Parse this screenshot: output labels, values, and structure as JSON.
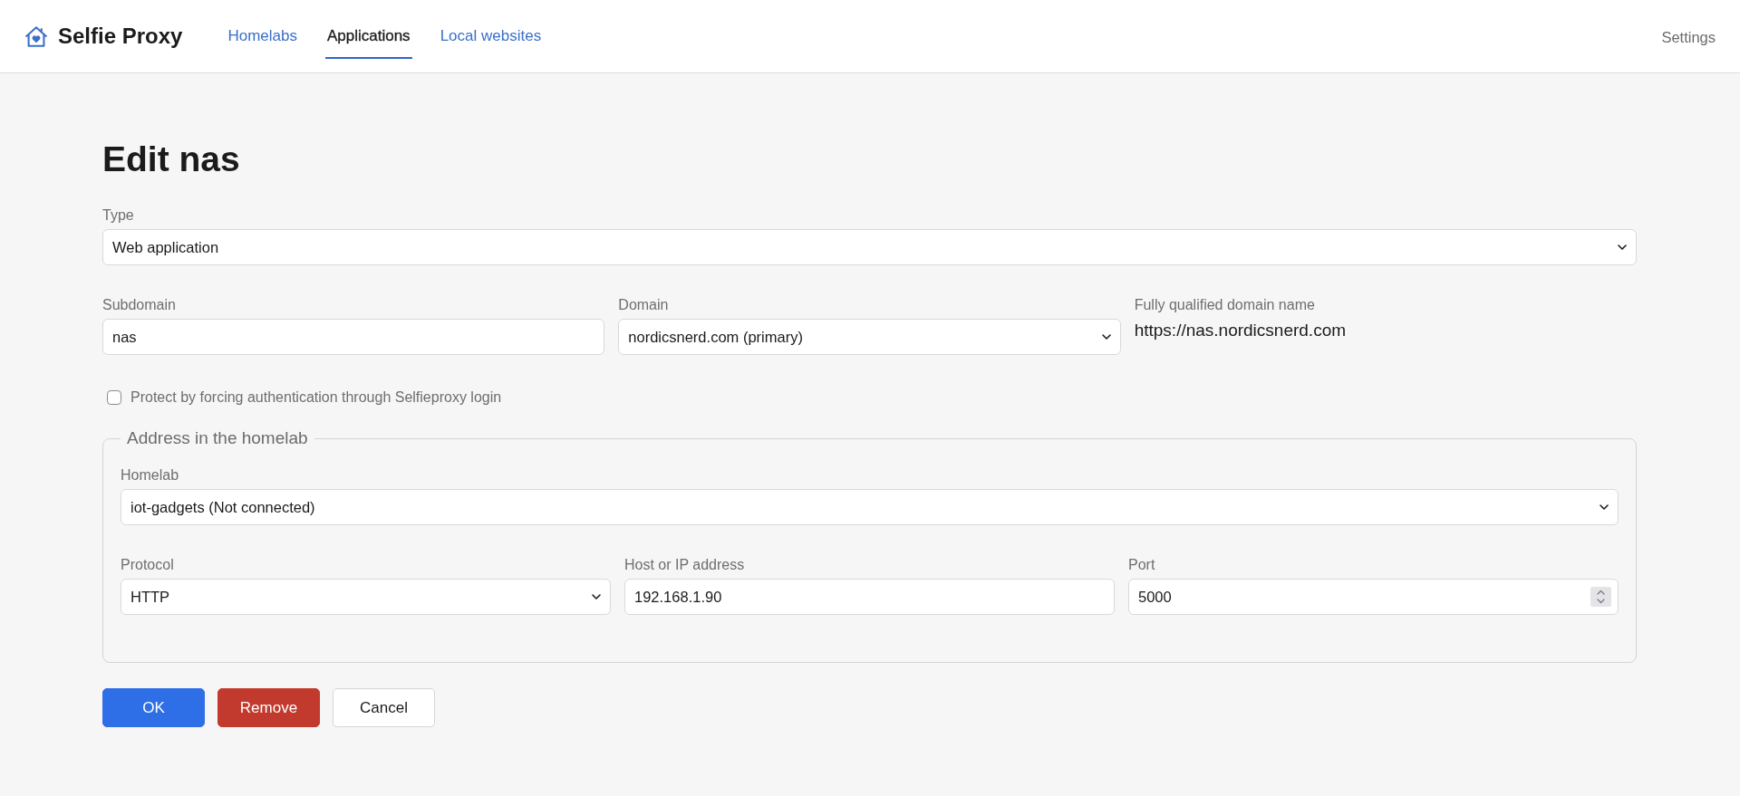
{
  "navbar": {
    "brand": "Selfie Proxy",
    "links": [
      {
        "label": "Homelabs",
        "selected": false
      },
      {
        "label": "Applications",
        "selected": true
      },
      {
        "label": "Local websites",
        "selected": false
      }
    ],
    "settings": "Settings"
  },
  "title": "Edit nas",
  "form_rows": [
    {
      "fields": [
        {
          "kind": "select",
          "label": "Type",
          "value": "Web application"
        }
      ]
    },
    {
      "fields": [
        {
          "kind": "text",
          "label": "Subdomain",
          "value": "nas"
        },
        {
          "kind": "select",
          "label": "Domain",
          "value": "nordicsnerd.com (primary)"
        },
        {
          "kind": "readout",
          "label": "Fully qualified domain name",
          "value": "https://nas.nordicsnerd.com"
        }
      ]
    }
  ],
  "protect": {
    "label": "Protect by forcing authentication through Selfieproxy login",
    "checked": false
  },
  "homelab_address": {
    "legend": "Address in the homelab",
    "rows": [
      {
        "fields": [
          {
            "kind": "select",
            "label": "Homelab",
            "value": "iot-gadgets (Not connected)"
          }
        ]
      },
      {
        "fields": [
          {
            "kind": "select",
            "label": "Protocol",
            "value": "HTTP"
          },
          {
            "kind": "text",
            "label": "Host or IP address",
            "value": "192.168.1.90"
          },
          {
            "kind": "number",
            "label": "Port",
            "value": "5000"
          }
        ]
      }
    ]
  },
  "buttons": [
    {
      "label": "OK",
      "kind": "primary"
    },
    {
      "label": "Remove",
      "kind": "danger"
    },
    {
      "label": "Cancel",
      "kind": "secondary"
    }
  ]
}
